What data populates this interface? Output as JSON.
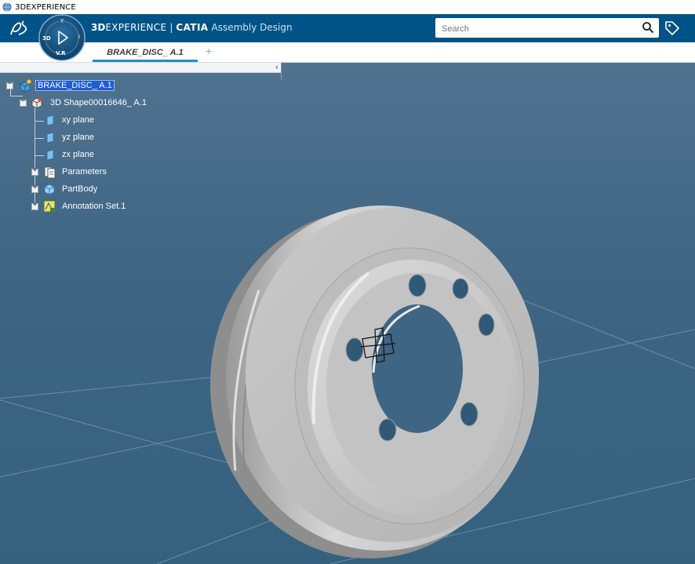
{
  "os_window": {
    "title": "3DEXPERIENCE"
  },
  "header": {
    "brand_3d": "3D",
    "brand_experience": "EXPERIENCE",
    "brand_separator": "|",
    "brand_product": "CATIA",
    "brand_app": "Assembly Design",
    "search_placeholder": "Search"
  },
  "compass": {
    "top_label": "Y",
    "left_label": "3D",
    "right_label": "i",
    "bottom_label": "V.R"
  },
  "tabs": [
    {
      "label": "BRAKE_DISC_ A.1",
      "active": true
    }
  ],
  "add_tab_label": "+",
  "panel_collapse_glyph": "‹",
  "tree": [
    {
      "label": "BRAKE_DISC_ A.1",
      "icon": "product-icon",
      "selected": true
    },
    {
      "label": "3D Shape00016646_ A.1",
      "icon": "3d-shape-icon"
    },
    {
      "label": "xy plane",
      "icon": "plane-icon"
    },
    {
      "label": "yz plane",
      "icon": "plane-icon"
    },
    {
      "label": "zx plane",
      "icon": "plane-icon"
    },
    {
      "label": "Parameters",
      "icon": "parameters-icon"
    },
    {
      "label": "PartBody",
      "icon": "partbody-icon"
    },
    {
      "label": "Annotation Set.1",
      "icon": "annotation-set-icon"
    }
  ],
  "colors": {
    "header_bg": "#005386",
    "viewport_bg": "#3e6583",
    "tab_accent": "#2a86c7",
    "selection_bg": "#1e5bd8"
  }
}
